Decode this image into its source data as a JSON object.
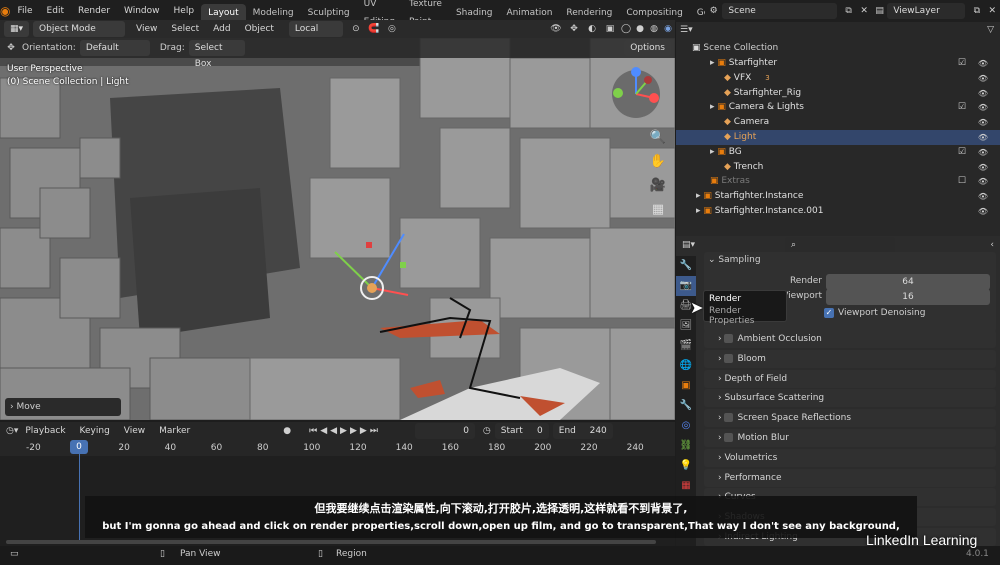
{
  "menu": [
    "File",
    "Edit",
    "Render",
    "Window",
    "Help"
  ],
  "workspace_tabs": [
    "Layout",
    "Modeling",
    "Sculpting",
    "UV Editing",
    "Texture Paint",
    "Shading",
    "Animation",
    "Rendering",
    "Compositing",
    "Geome"
  ],
  "active_tab": "Layout",
  "scene_name": "Scene",
  "view_layer": "ViewLayer",
  "viewport_header": {
    "mode": "Object Mode",
    "view": "View",
    "select": "Select",
    "add": "Add",
    "object": "Object",
    "transform": "Local"
  },
  "tool_header": {
    "orientation_label": "Orientation:",
    "orientation_value": "Default",
    "drag_label": "Drag:",
    "drag_value": "Select Box",
    "options": "Options"
  },
  "viewport_info": {
    "line1": "User Perspective",
    "line2": "(0) Scene Collection | Light"
  },
  "last_operation": "Move",
  "outliner": {
    "root": "Scene Collection",
    "rows": [
      {
        "label": "Starfighter",
        "indent": 1,
        "color": "#e0e0e0"
      },
      {
        "label": "VFX",
        "indent": 2,
        "color": "#e0e0e0"
      },
      {
        "label": "Starfighter_Rig",
        "indent": 2,
        "color": "#e0e0e0"
      },
      {
        "label": "Camera & Lights",
        "indent": 1,
        "color": "#e0e0e0"
      },
      {
        "label": "Camera",
        "indent": 2,
        "color": "#e0e0e0"
      },
      {
        "label": "Light",
        "indent": 2,
        "color": "#e6a257"
      },
      {
        "label": "BG",
        "indent": 1,
        "color": "#e0e0e0"
      },
      {
        "label": "Trench",
        "indent": 2,
        "color": "#e0e0e0"
      },
      {
        "label": "Extras",
        "indent": 1,
        "color": "#7a7a7a"
      },
      {
        "label": "Starfighter.Instance",
        "indent": 0,
        "color": "#e0e0e0"
      },
      {
        "label": "Starfighter.Instance.001",
        "indent": 0,
        "color": "#e0e0e0"
      }
    ],
    "vfx_count": "3"
  },
  "properties": {
    "search_placeholder": "",
    "sampling": "Sampling",
    "render_label": "Render",
    "render_value": "64",
    "viewport_label": "Viewport",
    "viewport_value": "16",
    "denoise": "Viewport Denoising",
    "tooltip_title": "Render",
    "tooltip_desc": "Render Properties",
    "panels": [
      "Ambient Occlusion",
      "Bloom",
      "Depth of Field",
      "Subsurface Scattering",
      "Screen Space Reflections",
      "Motion Blur",
      "Volumetrics",
      "Performance",
      "Curves",
      "Shadows",
      "Indirect Lighting"
    ],
    "panels_with_checkbox": [
      true,
      true,
      false,
      false,
      true,
      true,
      false,
      false,
      false,
      false,
      false
    ]
  },
  "timeline": {
    "playback": "Playback",
    "keying": "Keying",
    "view": "View",
    "marker": "Marker",
    "current_frame": "0",
    "start_label": "Start",
    "start": "0",
    "end_label": "End",
    "end": "240",
    "ticks": [
      "-20",
      "0",
      "20",
      "40",
      "60",
      "80",
      "100",
      "120",
      "140",
      "160",
      "180",
      "200",
      "220",
      "240"
    ],
    "playhead": "0"
  },
  "statusbar": {
    "pan": "Pan View",
    "region": "Region",
    "version": "4.0.1"
  },
  "subtitles": {
    "zh": "但我要继续点击渲染属性,向下滚动,打开胶片,选择透明,这样就看不到背景了,",
    "en": "but I'm gonna go ahead and click on render properties,scroll down,open up film, and go to transparent,That way I don't see any background,"
  },
  "watermark": "LinkedIn Learning",
  "colors": {
    "accent": "#4772b3",
    "selected_row": "#33466b",
    "light_text": "#e6a257",
    "orange": "#e87d0d"
  }
}
